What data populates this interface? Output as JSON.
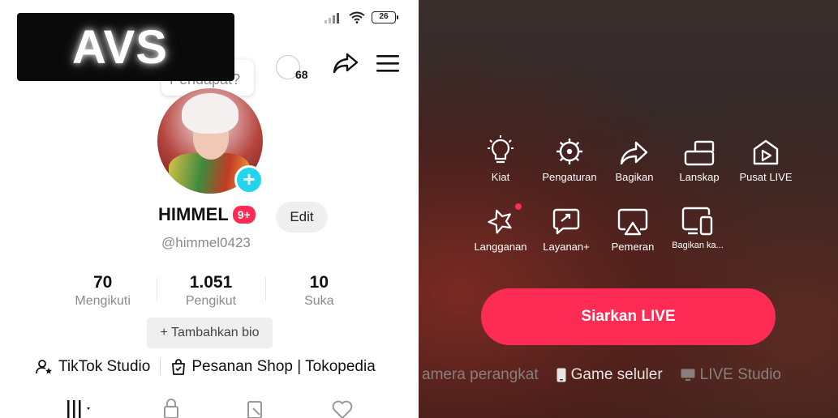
{
  "status": {
    "battery": "26"
  },
  "watermark": {
    "text": "AVS"
  },
  "header": {
    "friends_count": "68"
  },
  "tooltip": {
    "text": "Pendapat?"
  },
  "profile": {
    "username": "HIMMEL",
    "badge": "9+",
    "edit_label": "Edit",
    "handle": "@himmel0423",
    "plus": "+"
  },
  "stats": [
    {
      "value": "70",
      "label": "Mengikuti"
    },
    {
      "value": "1.051",
      "label": "Pengikut"
    },
    {
      "value": "10",
      "label": "Suka"
    }
  ],
  "bio_button": "+ Tambahkan bio",
  "links": {
    "studio": "TikTok Studio",
    "shop": "Pesanan Shop | Tokopedia"
  },
  "live_menu": {
    "items": [
      {
        "label": "Kiat",
        "icon": "lightbulb-icon"
      },
      {
        "label": "Pengaturan",
        "icon": "settings-icon"
      },
      {
        "label": "Bagikan",
        "icon": "share-icon"
      },
      {
        "label": "Lanskap",
        "icon": "landscape-icon"
      },
      {
        "label": "Pusat LIVE",
        "icon": "live-center-icon"
      },
      {
        "label": "Langganan",
        "icon": "subscription-icon"
      },
      {
        "label": "Layanan+",
        "icon": "services-icon"
      },
      {
        "label": "Pemeran",
        "icon": "cast-icon"
      },
      {
        "label": "Bagikan ka...",
        "icon": "share-screen-icon"
      }
    ],
    "go_live": "Siarkan LIVE"
  },
  "source_tabs": {
    "camera": "amera perangkat",
    "mobile_game": "Game seluler",
    "live_studio": "LIVE Studio"
  },
  "colors": {
    "accent": "#fe2c55",
    "plus_badge": "#20d5ec"
  }
}
